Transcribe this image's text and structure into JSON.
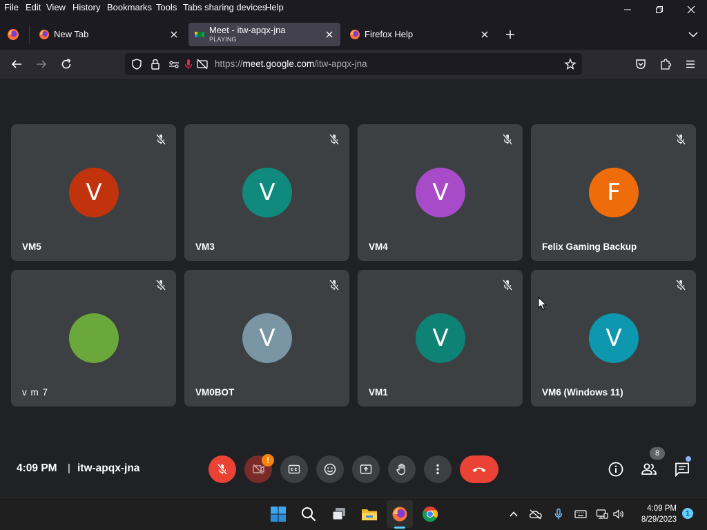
{
  "menubar": {
    "items": [
      "File",
      "Edit",
      "View",
      "History",
      "Bookmarks",
      "Tools",
      "Tabs sharing devices",
      "Help"
    ]
  },
  "tabs": [
    {
      "title": "New Tab",
      "subtitle": ""
    },
    {
      "title": "Meet - itw-apqx-jna",
      "subtitle": "PLAYING"
    },
    {
      "title": "Firefox Help",
      "subtitle": ""
    }
  ],
  "url": {
    "prefix": "https://",
    "host": "meet.google.com",
    "path": "/itw-apqx-jna"
  },
  "participants": [
    {
      "initial": "V",
      "name": "VM5",
      "color": "#c1330c"
    },
    {
      "initial": "V",
      "name": "VM3",
      "color": "#0f8a7d"
    },
    {
      "initial": "V",
      "name": "VM4",
      "color": "#a84bc9"
    },
    {
      "initial": "F",
      "name": "Felix Gaming Backup",
      "color": "#ee6c0a"
    },
    {
      "initial": "",
      "name": "v m 7",
      "color": "#6aa83b"
    },
    {
      "initial": "V",
      "name": "VM0BOT",
      "color": "#7a95a4"
    },
    {
      "initial": "V",
      "name": "VM1",
      "color": "#0e8274"
    },
    {
      "initial": "V",
      "name": "VM6 (Windows 11)",
      "color": "#0e98b0"
    }
  ],
  "meeting": {
    "time": "4:09 PM",
    "separator": "|",
    "code": "itw-apqx-jna",
    "camera_alert": "!",
    "people_count": "8"
  },
  "taskbar": {
    "clock_time": "4:09 PM",
    "clock_date": "8/29/2023",
    "notification_count": "1"
  }
}
